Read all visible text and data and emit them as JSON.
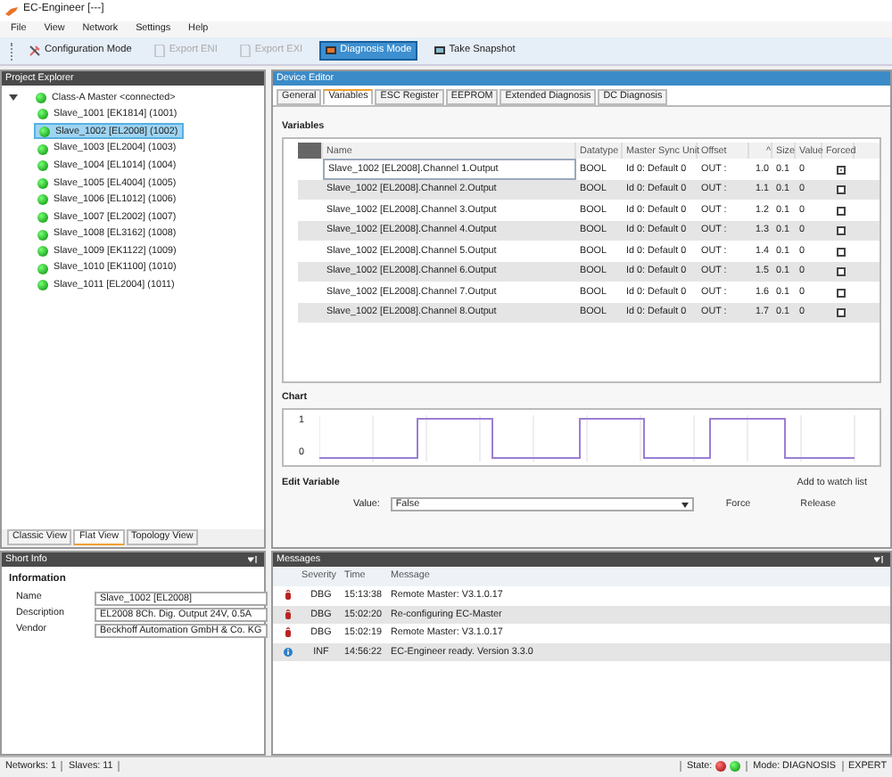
{
  "window": {
    "title": "EC-Engineer [---]"
  },
  "menu": [
    "File",
    "View",
    "Network",
    "Settings",
    "Help"
  ],
  "toolbar": [
    {
      "label": "Configuration Mode",
      "kind": "config",
      "disabled": false,
      "selected": false
    },
    {
      "label": "Export ENI",
      "kind": "export",
      "disabled": true,
      "selected": false
    },
    {
      "label": "Export EXI",
      "kind": "export",
      "disabled": true,
      "selected": false
    },
    {
      "label": "Diagnosis Mode",
      "kind": "diag",
      "disabled": false,
      "selected": true
    },
    {
      "label": "Take Snapshot",
      "kind": "snapshot",
      "disabled": false,
      "selected": false
    }
  ],
  "project_explorer": {
    "title": "Project Explorer",
    "tree": [
      {
        "label": "Class-A Master <connected>",
        "expanded": true,
        "selected": false,
        "children": [
          {
            "label": "Slave_1001 [EK1814] (1001)",
            "selected": false
          },
          {
            "label": "Slave_1002 [EL2008] (1002)",
            "selected": true
          },
          {
            "label": "Slave_1003 [EL2004] (1003)",
            "selected": false
          },
          {
            "label": "Slave_1004 [EL1014] (1004)",
            "selected": false
          },
          {
            "label": "Slave_1005 [EL4004] (1005)",
            "selected": false
          },
          {
            "label": "Slave_1006 [EL1012] (1006)",
            "selected": false
          },
          {
            "label": "Slave_1007 [EL2002] (1007)",
            "selected": false
          },
          {
            "label": "Slave_1008 [EL3162] (1008)",
            "selected": false
          },
          {
            "label": "Slave_1009 [EK1122] (1009)",
            "selected": false
          },
          {
            "label": "Slave_1010 [EK1100] (1010)",
            "selected": false
          },
          {
            "label": "Slave_1011 [EL2004] (1011)",
            "selected": false
          }
        ]
      }
    ],
    "tabs": [
      {
        "label": "Classic View",
        "selected": false
      },
      {
        "label": "Flat View",
        "selected": true
      },
      {
        "label": "Topology View",
        "selected": false
      }
    ]
  },
  "device_editor": {
    "title": "Device Editor",
    "tabs": [
      {
        "label": "General",
        "selected": false
      },
      {
        "label": "Variables",
        "selected": true
      },
      {
        "label": "ESC Register",
        "selected": false
      },
      {
        "label": "EEPROM",
        "selected": false
      },
      {
        "label": "Extended Diagnosis",
        "selected": false
      },
      {
        "label": "DC Diagnosis",
        "selected": false
      }
    ],
    "variables_title": "Variables",
    "columns": [
      "Name",
      "Datatype",
      "Master Sync Unit",
      "Offset",
      "^",
      "Size",
      "Value",
      "Forced"
    ],
    "rows": [
      {
        "name": "Slave_1002 [EL2008].Channel 1.Output",
        "datatype": "BOOL",
        "sync_unit": "Id 0: Default 0",
        "offset": "OUT :",
        "bit": "1.0",
        "size": "0.1",
        "value": "0",
        "forced": true,
        "selected": true
      },
      {
        "name": "Slave_1002 [EL2008].Channel 2.Output",
        "datatype": "BOOL",
        "sync_unit": "Id 0: Default 0",
        "offset": "OUT :",
        "bit": "1.1",
        "size": "0.1",
        "value": "0",
        "forced": false,
        "selected": false
      },
      {
        "name": "Slave_1002 [EL2008].Channel 3.Output",
        "datatype": "BOOL",
        "sync_unit": "Id 0: Default 0",
        "offset": "OUT :",
        "bit": "1.2",
        "size": "0.1",
        "value": "0",
        "forced": false,
        "selected": false
      },
      {
        "name": "Slave_1002 [EL2008].Channel 4.Output",
        "datatype": "BOOL",
        "sync_unit": "Id 0: Default 0",
        "offset": "OUT :",
        "bit": "1.3",
        "size": "0.1",
        "value": "0",
        "forced": false,
        "selected": false
      },
      {
        "name": "Slave_1002 [EL2008].Channel 5.Output",
        "datatype": "BOOL",
        "sync_unit": "Id 0: Default 0",
        "offset": "OUT :",
        "bit": "1.4",
        "size": "0.1",
        "value": "0",
        "forced": false,
        "selected": false
      },
      {
        "name": "Slave_1002 [EL2008].Channel 6.Output",
        "datatype": "BOOL",
        "sync_unit": "Id 0: Default 0",
        "offset": "OUT :",
        "bit": "1.5",
        "size": "0.1",
        "value": "0",
        "forced": false,
        "selected": false
      },
      {
        "name": "Slave_1002 [EL2008].Channel 7.Output",
        "datatype": "BOOL",
        "sync_unit": "Id 0: Default 0",
        "offset": "OUT :",
        "bit": "1.6",
        "size": "0.1",
        "value": "0",
        "forced": false,
        "selected": false
      },
      {
        "name": "Slave_1002 [EL2008].Channel 8.Output",
        "datatype": "BOOL",
        "sync_unit": "Id 0: Default 0",
        "offset": "OUT :",
        "bit": "1.7",
        "size": "0.1",
        "value": "0",
        "forced": false,
        "selected": false
      }
    ],
    "chart": {
      "title": "Chart",
      "y_labels": [
        "1",
        "0"
      ]
    },
    "edit_variable": {
      "title": "Edit Variable",
      "watch_link": "Add to watch list",
      "value_label": "Value:",
      "value": "False",
      "force": "Force",
      "release": "Release"
    }
  },
  "short_info": {
    "title": "Short Info",
    "section": "Information",
    "fields": [
      {
        "label": "Name",
        "value": "Slave_1002 [EL2008]"
      },
      {
        "label": "Description",
        "value": "EL2008 8Ch. Dig. Output 24V, 0.5A"
      },
      {
        "label": "Vendor",
        "value": "Beckhoff Automation GmbH & Co. KG"
      }
    ]
  },
  "messages": {
    "title": "Messages",
    "columns": [
      "Severity",
      "Time",
      "Message"
    ],
    "rows": [
      {
        "kind": "debug",
        "severity": "DBG",
        "time": "15:13:38",
        "message": "Remote Master: V3.1.0.17"
      },
      {
        "kind": "debug",
        "severity": "DBG",
        "time": "15:02:20",
        "message": "Re-configuring EC-Master"
      },
      {
        "kind": "debug",
        "severity": "DBG",
        "time": "15:02:19",
        "message": "Remote Master: V3.1.0.17"
      },
      {
        "kind": "info",
        "severity": "INF",
        "time": "14:56:22",
        "message": "EC-Engineer ready. Version 3.3.0"
      }
    ]
  },
  "status_bar": {
    "networks": "Networks: 1",
    "slaves": "Slaves: 11",
    "state_label": "State:",
    "mode": "Mode: DIAGNOSIS",
    "level": "EXPERT"
  }
}
